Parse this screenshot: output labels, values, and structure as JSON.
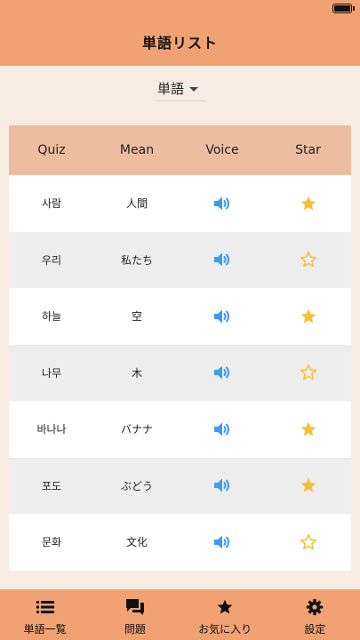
{
  "header": {
    "title": "単語リスト"
  },
  "filter": {
    "selected": "単語"
  },
  "table": {
    "columns": [
      "Quiz",
      "Mean",
      "Voice",
      "Star"
    ],
    "rows": [
      {
        "quiz": "사람",
        "mean": "人間",
        "starred": true
      },
      {
        "quiz": "우리",
        "mean": "私たち",
        "starred": false
      },
      {
        "quiz": "하늘",
        "mean": "空",
        "starred": true
      },
      {
        "quiz": "나무",
        "mean": "木",
        "starred": false
      },
      {
        "quiz": "바나나",
        "mean": "バナナ",
        "starred": true
      },
      {
        "quiz": "포도",
        "mean": "ぶどう",
        "starred": true
      },
      {
        "quiz": "문화",
        "mean": "文化",
        "starred": false
      }
    ]
  },
  "tabs": [
    {
      "label": "単語一覧",
      "icon": "list-icon"
    },
    {
      "label": "問題",
      "icon": "chat-bubbles-icon"
    },
    {
      "label": "お気に入り",
      "icon": "star-icon"
    },
    {
      "label": "設定",
      "icon": "gear-icon"
    }
  ],
  "colors": {
    "accent": "#f0a273",
    "header_row": "#eebda1",
    "background": "#f8ebe2",
    "speaker": "#3b9cf0",
    "star": "#f8be34"
  }
}
